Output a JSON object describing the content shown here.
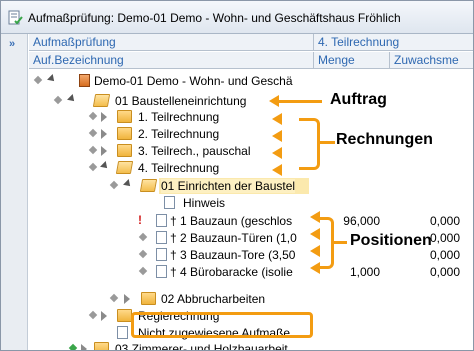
{
  "window": {
    "title": "Aufmaßprüfung: Demo-01 Demo - Wohn- und Geschäftshaus Fröhlich",
    "expand_glyph": "»"
  },
  "headers": {
    "row1": {
      "left": "Aufmaßprüfung",
      "right": "4. Teilrechnung"
    },
    "row2": {
      "col1": "Auf.Bezeichnung",
      "col2": "Menge",
      "col3": "Zuwachsme"
    }
  },
  "tree": [
    {
      "label": "Demo-01 Demo - Wohn- und Geschä",
      "icon": "book-icon"
    },
    {
      "label": "01 Baustelleneinrichtung",
      "icon": "folder-open-icon"
    },
    {
      "label": "1. Teilrechnung",
      "icon": "folder-icon"
    },
    {
      "label": "2. Teilrechnung",
      "icon": "folder-icon"
    },
    {
      "label": "3. Teilrech., pauschal",
      "icon": "folder-icon"
    },
    {
      "label": "4. Teilrechnung",
      "icon": "folder-open-icon"
    },
    {
      "label": "01 Einrichten der Baustel",
      "icon": "folder-open-icon"
    },
    {
      "label": "Hinweis",
      "icon": "document-icon"
    },
    {
      "label": "1 Bauzaun (geschlos",
      "icon": "position-icon",
      "menge": "96,000",
      "zuwachs": "0,000"
    },
    {
      "label": "2 Bauzaun-Türen (1,0",
      "icon": "position-icon",
      "menge": "",
      "zuwachs": "0,000"
    },
    {
      "label": "3 Bauzaun-Tore (3,50",
      "icon": "position-icon",
      "menge": "",
      "zuwachs": "0,000"
    },
    {
      "label": "4 Bürobaracke (isolie",
      "icon": "position-icon",
      "menge": "1,000",
      "zuwachs": "0,000"
    },
    {
      "label": "02 Abbrucharbeiten",
      "icon": "folder-icon"
    },
    {
      "label": "Regierechnung",
      "icon": "folder-icon"
    },
    {
      "label": "Nicht zugewiesene Aufmaße",
      "icon": "document-icon"
    },
    {
      "label": "03 Zimmerer- und Holzbauarbeit",
      "icon": "folder-icon"
    }
  ],
  "annotations": {
    "auftrag": "Auftrag",
    "rechnungen": "Rechnungen",
    "positionen": "Positionen"
  },
  "colors": {
    "header_text": "#2e68b1",
    "highlight": "#f39c12",
    "selection": "#fbe9ad"
  }
}
